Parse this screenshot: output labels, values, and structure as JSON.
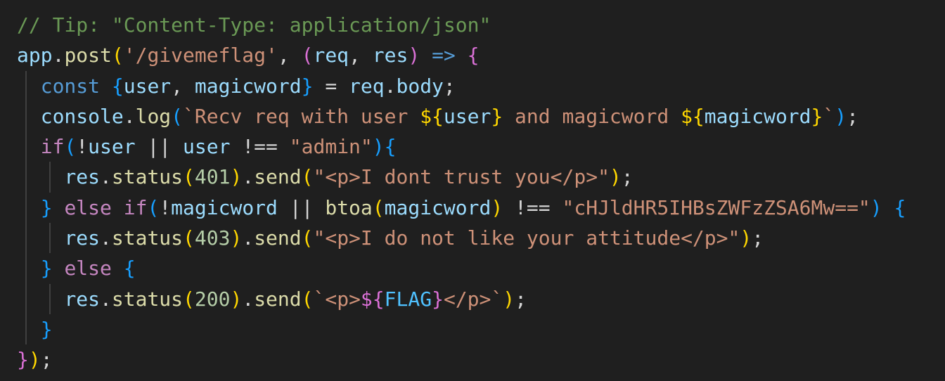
{
  "editor": {
    "theme_colors": {
      "background": "#1f1f1f",
      "comment": "#6a9955",
      "variable": "#9cdcfe",
      "function": "#dcdcaa",
      "string": "#ce9178",
      "keyword_blue": "#569cd6",
      "keyword_purple": "#c586c0",
      "number": "#b5cea8",
      "bracket_level1": "#ffd700",
      "bracket_level2": "#da70d6",
      "bracket_level3": "#179fff"
    },
    "lines": [
      {
        "indent": 0,
        "tokens": [
          {
            "t": "// Tip: \"Content-Type: application/json\"",
            "c": "comment"
          }
        ]
      },
      {
        "indent": 0,
        "tokens": [
          {
            "t": "app",
            "c": "var"
          },
          {
            "t": ".",
            "c": "text"
          },
          {
            "t": "post",
            "c": "fn"
          },
          {
            "t": "(",
            "c": "br1"
          },
          {
            "t": "'/givemeflag'",
            "c": "str"
          },
          {
            "t": ", ",
            "c": "text"
          },
          {
            "t": "(",
            "c": "br2"
          },
          {
            "t": "req",
            "c": "var"
          },
          {
            "t": ", ",
            "c": "text"
          },
          {
            "t": "res",
            "c": "var"
          },
          {
            "t": ")",
            "c": "br2"
          },
          {
            "t": " ",
            "c": "text"
          },
          {
            "t": "=>",
            "c": "kw-blue"
          },
          {
            "t": " ",
            "c": "text"
          },
          {
            "t": "{",
            "c": "br2"
          }
        ]
      },
      {
        "indent": 1,
        "tokens": [
          {
            "t": "const",
            "c": "kw-blue"
          },
          {
            "t": " ",
            "c": "text"
          },
          {
            "t": "{",
            "c": "br3"
          },
          {
            "t": "user",
            "c": "var"
          },
          {
            "t": ", ",
            "c": "text"
          },
          {
            "t": "magicword",
            "c": "var"
          },
          {
            "t": "}",
            "c": "br3"
          },
          {
            "t": " = ",
            "c": "text"
          },
          {
            "t": "req",
            "c": "var"
          },
          {
            "t": ".",
            "c": "text"
          },
          {
            "t": "body",
            "c": "var"
          },
          {
            "t": ";",
            "c": "text"
          }
        ]
      },
      {
        "indent": 1,
        "tokens": [
          {
            "t": "console",
            "c": "var"
          },
          {
            "t": ".",
            "c": "text"
          },
          {
            "t": "log",
            "c": "fn"
          },
          {
            "t": "(",
            "c": "br3"
          },
          {
            "t": "`Recv req with user ",
            "c": "str"
          },
          {
            "t": "${",
            "c": "br1"
          },
          {
            "t": "user",
            "c": "var"
          },
          {
            "t": "}",
            "c": "br1"
          },
          {
            "t": " and magicword ",
            "c": "str"
          },
          {
            "t": "${",
            "c": "br1"
          },
          {
            "t": "magicword",
            "c": "var"
          },
          {
            "t": "}",
            "c": "br1"
          },
          {
            "t": "`",
            "c": "str"
          },
          {
            "t": ")",
            "c": "br3"
          },
          {
            "t": ";",
            "c": "text"
          }
        ]
      },
      {
        "indent": 1,
        "tokens": [
          {
            "t": "if",
            "c": "kw-purple"
          },
          {
            "t": "(",
            "c": "br3"
          },
          {
            "t": "!",
            "c": "text"
          },
          {
            "t": "user",
            "c": "var"
          },
          {
            "t": " || ",
            "c": "text"
          },
          {
            "t": "user",
            "c": "var"
          },
          {
            "t": " !== ",
            "c": "text"
          },
          {
            "t": "\"admin\"",
            "c": "str"
          },
          {
            "t": ")",
            "c": "br3"
          },
          {
            "t": "{",
            "c": "br3"
          }
        ]
      },
      {
        "indent": 2,
        "tokens": [
          {
            "t": "res",
            "c": "var"
          },
          {
            "t": ".",
            "c": "text"
          },
          {
            "t": "status",
            "c": "fn"
          },
          {
            "t": "(",
            "c": "br1"
          },
          {
            "t": "401",
            "c": "num"
          },
          {
            "t": ")",
            "c": "br1"
          },
          {
            "t": ".",
            "c": "text"
          },
          {
            "t": "send",
            "c": "fn"
          },
          {
            "t": "(",
            "c": "br1"
          },
          {
            "t": "\"<p>I dont trust you</p>\"",
            "c": "str"
          },
          {
            "t": ")",
            "c": "br1"
          },
          {
            "t": ";",
            "c": "text"
          }
        ]
      },
      {
        "indent": 1,
        "tokens": [
          {
            "t": "}",
            "c": "br3"
          },
          {
            "t": " ",
            "c": "text"
          },
          {
            "t": "else",
            "c": "kw-purple"
          },
          {
            "t": " ",
            "c": "text"
          },
          {
            "t": "if",
            "c": "kw-purple"
          },
          {
            "t": "(",
            "c": "br3"
          },
          {
            "t": "!",
            "c": "text"
          },
          {
            "t": "magicword",
            "c": "var"
          },
          {
            "t": " || ",
            "c": "text"
          },
          {
            "t": "btoa",
            "c": "fn"
          },
          {
            "t": "(",
            "c": "br1"
          },
          {
            "t": "magicword",
            "c": "var"
          },
          {
            "t": ")",
            "c": "br1"
          },
          {
            "t": " !== ",
            "c": "text"
          },
          {
            "t": "\"cHJldHR5IHBsZWFzZSA6Mw==\"",
            "c": "str"
          },
          {
            "t": ")",
            "c": "br3"
          },
          {
            "t": " ",
            "c": "text"
          },
          {
            "t": "{",
            "c": "br3"
          }
        ]
      },
      {
        "indent": 2,
        "tokens": [
          {
            "t": "res",
            "c": "var"
          },
          {
            "t": ".",
            "c": "text"
          },
          {
            "t": "status",
            "c": "fn"
          },
          {
            "t": "(",
            "c": "br1"
          },
          {
            "t": "403",
            "c": "num"
          },
          {
            "t": ")",
            "c": "br1"
          },
          {
            "t": ".",
            "c": "text"
          },
          {
            "t": "send",
            "c": "fn"
          },
          {
            "t": "(",
            "c": "br1"
          },
          {
            "t": "\"<p>I do not like your attitude</p>\"",
            "c": "str"
          },
          {
            "t": ")",
            "c": "br1"
          },
          {
            "t": ";",
            "c": "text"
          }
        ]
      },
      {
        "indent": 1,
        "tokens": [
          {
            "t": "}",
            "c": "br3"
          },
          {
            "t": " ",
            "c": "text"
          },
          {
            "t": "else",
            "c": "kw-purple"
          },
          {
            "t": " ",
            "c": "text"
          },
          {
            "t": "{",
            "c": "br3"
          }
        ]
      },
      {
        "indent": 2,
        "tokens": [
          {
            "t": "res",
            "c": "var"
          },
          {
            "t": ".",
            "c": "text"
          },
          {
            "t": "status",
            "c": "fn"
          },
          {
            "t": "(",
            "c": "br1"
          },
          {
            "t": "200",
            "c": "num"
          },
          {
            "t": ")",
            "c": "br1"
          },
          {
            "t": ".",
            "c": "text"
          },
          {
            "t": "send",
            "c": "fn"
          },
          {
            "t": "(",
            "c": "br1"
          },
          {
            "t": "`<p>",
            "c": "str"
          },
          {
            "t": "${",
            "c": "br2"
          },
          {
            "t": "FLAG",
            "c": "const"
          },
          {
            "t": "}",
            "c": "br2"
          },
          {
            "t": "</p>`",
            "c": "str"
          },
          {
            "t": ")",
            "c": "br1"
          },
          {
            "t": ";",
            "c": "text"
          }
        ]
      },
      {
        "indent": 1,
        "tokens": [
          {
            "t": "}",
            "c": "br3"
          }
        ]
      },
      {
        "indent": 0,
        "tokens": [
          {
            "t": "}",
            "c": "br2"
          },
          {
            "t": ")",
            "c": "br1"
          },
          {
            "t": ";",
            "c": "text"
          }
        ]
      }
    ]
  }
}
